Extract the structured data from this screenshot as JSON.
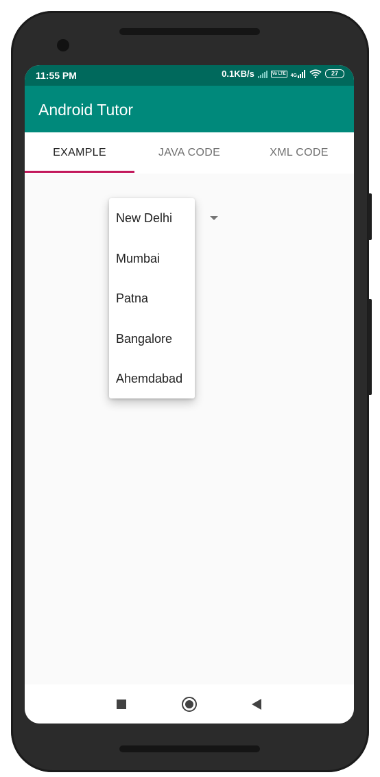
{
  "status_bar": {
    "time": "11:55 PM",
    "net_speed": "0.1KB/s",
    "volte_tag": "Vo LTE",
    "network_tag": "4G",
    "battery": "27"
  },
  "app_bar": {
    "title": "Android Tutor"
  },
  "tabs": [
    {
      "label": "EXAMPLE",
      "active": true
    },
    {
      "label": "JAVA CODE",
      "active": false
    },
    {
      "label": "XML CODE",
      "active": false
    }
  ],
  "spinner": {
    "options": [
      "New Delhi",
      "Mumbai",
      "Patna",
      "Bangalore",
      "Ahemdabad"
    ]
  },
  "colors": {
    "status_bar": "#00695c",
    "app_bar": "#00897b",
    "tab_indicator": "#c2185b"
  },
  "icons": {
    "nav_recent": "square-icon",
    "nav_home": "circle-home-icon",
    "nav_back": "back-triangle-icon"
  }
}
